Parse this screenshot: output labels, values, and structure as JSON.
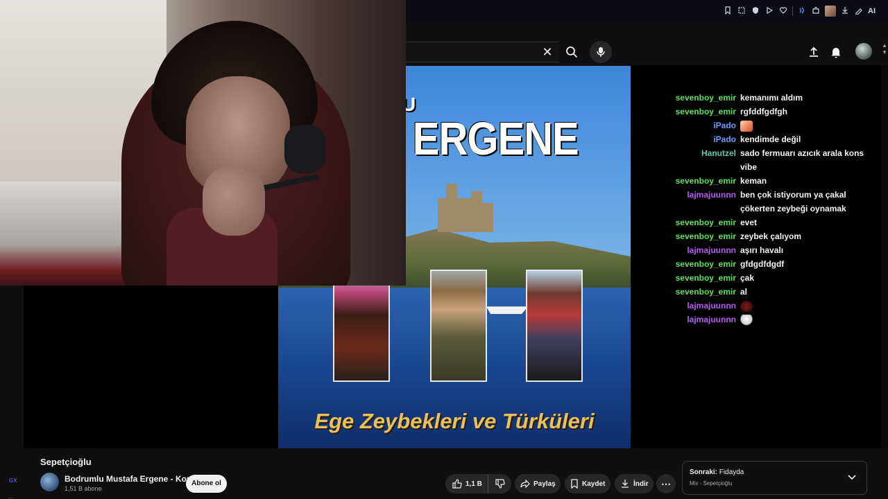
{
  "search": {
    "clear_glyph": "✕"
  },
  "extensions": [
    "bookmark-icon",
    "crop-icon",
    "shield-icon",
    "play-icon",
    "heart-icon",
    "audio-icon",
    "puzzle-icon",
    "profile-thumb",
    "download-icon",
    "ai-edit-icon"
  ],
  "extensions_ai_label": "AI",
  "side": {
    "gx_label": "GX",
    "dots": "..."
  },
  "thumbnail": {
    "title_top": "U",
    "title_main": "STAFA ERGENE",
    "subtitle": "Ege Zeybekleri ve Türküleri"
  },
  "chat": [
    {
      "user": "sevenboy_emir",
      "color": "#59e35a",
      "msg": "kemanımı aldım"
    },
    {
      "user": "sevenboy_emir",
      "color": "#59e35a",
      "msg": "rgfddfgdfgh"
    },
    {
      "user": "iPado",
      "color": "#6f9bff",
      "msg": "",
      "emote": "emote-a"
    },
    {
      "user": "iPado",
      "color": "#6f9bff",
      "msg": "kendimde değil"
    },
    {
      "user": "Hanutzel",
      "color": "#60c8b4",
      "msg": "sado fermuarı azıcık arala kons vibe"
    },
    {
      "user": "sevenboy_emir",
      "color": "#59e35a",
      "msg": "keman"
    },
    {
      "user": "lajmajuunnn",
      "color": "#b45cf0",
      "msg": "ben çok istiyorum ya çakal çökerten zeybeği oynamak"
    },
    {
      "user": "sevenboy_emir",
      "color": "#59e35a",
      "msg": "evet"
    },
    {
      "user": "sevenboy_emir",
      "color": "#59e35a",
      "msg": "zeybek çalıyom"
    },
    {
      "user": "lajmajuunnn",
      "color": "#b45cf0",
      "msg": "aşırı havalı"
    },
    {
      "user": "sevenboy_emir",
      "color": "#59e35a",
      "msg": "gfdgdfdgdf"
    },
    {
      "user": "sevenboy_emir",
      "color": "#59e35a",
      "msg": "çak"
    },
    {
      "user": "sevenboy_emir",
      "color": "#59e35a",
      "msg": "al"
    },
    {
      "user": "lajmajuunnn",
      "color": "#b45cf0",
      "msg": "",
      "emote": "emote-b"
    },
    {
      "user": "lajmajuunnn",
      "color": "#b45cf0",
      "msg": "",
      "emote": "emote-c"
    }
  ],
  "video": {
    "title": "Sepetçioğlu",
    "channel_name": "Bodrumlu Mustafa Ergene - Konu",
    "subscribers": "1,51 B abone",
    "subscribe_label": "Abone ol",
    "likes": "1,1 B",
    "share_label": "Paylaş",
    "save_label": "Kaydet",
    "download_label": "İndir",
    "more_label": "⋯"
  },
  "next": {
    "prefix": "Sonraki:",
    "title": "Fidayda",
    "playlist": "Mix - Sepetçioğlu"
  }
}
